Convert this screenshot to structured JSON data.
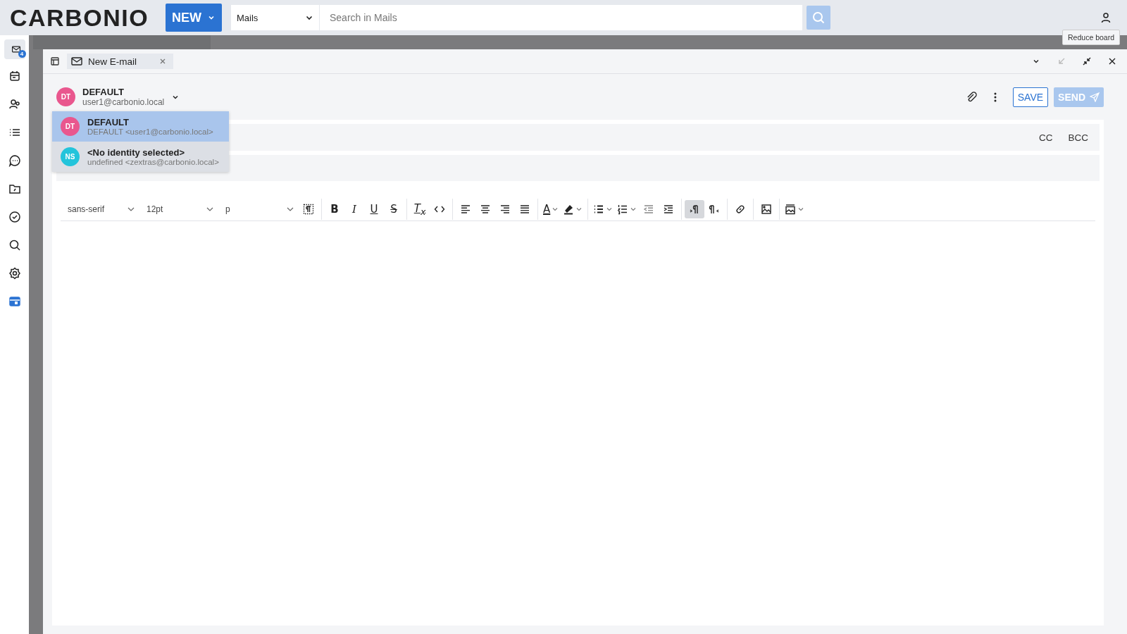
{
  "header": {
    "logo": "CARBONIO",
    "new_button": "NEW",
    "search_scope": "Mails",
    "search": {
      "placeholder": "Search in Mails"
    }
  },
  "sidebar": {
    "items": [
      {
        "kind": "mail",
        "selected": true,
        "active": false,
        "badge": "4"
      },
      {
        "kind": "calendar",
        "selected": false,
        "active": false
      },
      {
        "kind": "contacts",
        "selected": false,
        "active": false
      },
      {
        "kind": "list",
        "selected": false,
        "active": false
      },
      {
        "kind": "chat",
        "selected": false,
        "active": false
      },
      {
        "kind": "files",
        "selected": false,
        "active": false
      },
      {
        "kind": "tasks",
        "selected": false,
        "active": false
      },
      {
        "kind": "search",
        "selected": false,
        "active": false
      },
      {
        "kind": "settings",
        "selected": false,
        "active": false
      },
      {
        "kind": "board",
        "selected": false,
        "active": true
      }
    ]
  },
  "tooltip": "Reduce board",
  "board": {
    "tab": "New E-mail",
    "controls": [
      {
        "kind": "collapse",
        "disabled": false
      },
      {
        "kind": "minimize",
        "disabled": true
      },
      {
        "kind": "reduce",
        "disabled": false
      },
      {
        "kind": "close",
        "disabled": false
      }
    ],
    "from": {
      "initials": "DT",
      "color": "#e9578e",
      "name": "DEFAULT",
      "address": "user1@carbonio.local"
    },
    "identities": [
      {
        "initials": "DT",
        "color": "#e9578e",
        "name": "DEFAULT",
        "address": "DEFAULT <user1@carbonio.local>",
        "selected": true
      },
      {
        "initials": "NS",
        "color": "#23c4db",
        "name": "<No identity selected>",
        "address": "undefined <zextras@carbonio.local>",
        "selected": false
      }
    ],
    "save": "SAVE",
    "send": {
      "label": "SEND",
      "disabled": true
    },
    "cc": "CC",
    "bcc": "BCC",
    "font": "sans-serif",
    "size": "12pt",
    "format": "p",
    "tools": [
      {
        "kind": "blocks",
        "selected": false
      },
      {
        "kind": "sep"
      },
      {
        "kind": "bold",
        "glyph": "B",
        "selected": false
      },
      {
        "kind": "italic",
        "glyph": "I",
        "selected": false
      },
      {
        "kind": "underline",
        "glyph": "U",
        "selected": false
      },
      {
        "kind": "strike",
        "glyph": "S",
        "selected": false
      },
      {
        "kind": "sep"
      },
      {
        "kind": "clear",
        "glyph": "T$_{x}$",
        "selected": false
      },
      {
        "kind": "code",
        "selected": false
      },
      {
        "kind": "sep"
      },
      {
        "kind": "align-left",
        "selected": false
      },
      {
        "kind": "align-center",
        "selected": false
      },
      {
        "kind": "align-right",
        "selected": false
      },
      {
        "kind": "justify",
        "selected": false
      },
      {
        "kind": "sep"
      },
      {
        "kind": "text-color",
        "glyph": "A",
        "selected": false
      },
      {
        "kind": "highlight",
        "selected": false
      },
      {
        "kind": "sep"
      },
      {
        "kind": "bullets",
        "selected": false
      },
      {
        "kind": "numbers",
        "selected": false
      },
      {
        "kind": "outdent",
        "selected": false
      },
      {
        "kind": "indent",
        "selected": false
      },
      {
        "kind": "sep"
      },
      {
        "kind": "ltr",
        "selected": true
      },
      {
        "kind": "rtl",
        "selected": false
      },
      {
        "kind": "sep"
      },
      {
        "kind": "link",
        "selected": false
      },
      {
        "kind": "sep"
      },
      {
        "kind": "image",
        "selected": false
      },
      {
        "kind": "sep"
      },
      {
        "kind": "inline-image",
        "selected": false
      }
    ]
  }
}
